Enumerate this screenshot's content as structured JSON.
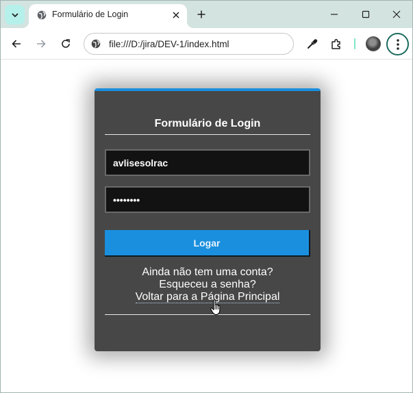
{
  "browser": {
    "tab": {
      "title": "Formulário de Login",
      "favicon": "globe-icon"
    },
    "url": "file:///D:/jira/DEV-1/index.html",
    "icons": [
      "tab-search-icon",
      "close-icon",
      "plus-icon",
      "minimize-icon",
      "maximize-icon",
      "close-window-icon",
      "back-arrow-icon",
      "forward-arrow-icon",
      "reload-icon",
      "globe-icon",
      "eyedropper-icon",
      "extensions-icon",
      "profile-avatar",
      "kebab-menu-icon"
    ],
    "colors": {
      "tabstrip": "#d3e3e0",
      "accent": "#1a6b5e"
    }
  },
  "login": {
    "title": "Formulário de Login",
    "username_value": "avlisesolrac",
    "password_value": "••••••••",
    "button_label": "Logar",
    "links": {
      "signup": "Ainda não tem uma conta?",
      "forgot": "Esqueceu a senha?",
      "back_home": "Voltar para a Página Principal"
    },
    "colors": {
      "card": "#474747",
      "accent": "#1a8fde",
      "field": "#121212"
    }
  }
}
